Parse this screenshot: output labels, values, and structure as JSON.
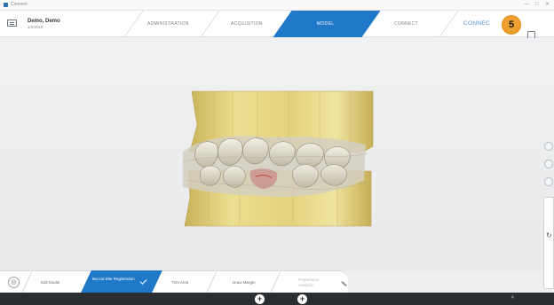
{
  "window": {
    "title": "Connect",
    "controls": [
      "—",
      "□",
      "✕"
    ]
  },
  "patient": {
    "name": "Demo, Demo",
    "date": "1/3/2019"
  },
  "tabs": [
    {
      "label": "ADMINISTRATION",
      "active": false
    },
    {
      "label": "ACQUISITION",
      "active": false
    },
    {
      "label": "MODEL",
      "active": true
    },
    {
      "label": "CONNECT",
      "active": false
    },
    {
      "label": "CONNEC",
      "active": false
    }
  ],
  "badge": {
    "number": "5"
  },
  "steps": [
    {
      "label": "Edit Model",
      "state": "done"
    },
    {
      "label": "Buccal Bite Registration",
      "state": "active"
    },
    {
      "label": "Trim Area",
      "state": "todo"
    },
    {
      "label": "Draw Margin",
      "state": "todo"
    },
    {
      "label": "Preparation Analysis",
      "state": "disabled"
    }
  ],
  "toolbar": {
    "add_left": "+",
    "add_right": "+",
    "right_text": "4"
  },
  "colors": {
    "accent": "#1f78c8",
    "badge": "#f0a030",
    "scan_gold": "#e2d27a"
  }
}
